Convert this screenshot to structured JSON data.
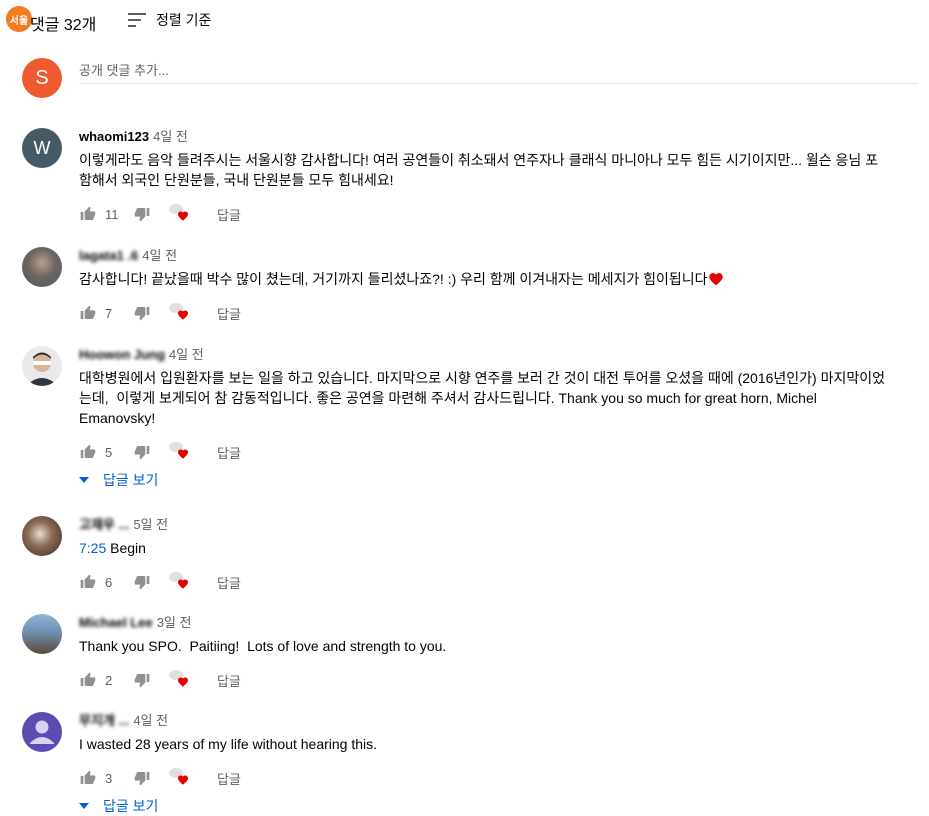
{
  "header": {
    "logo_text": "서울",
    "comment_count": "댓글 32개",
    "sort_label": "정렬 기준"
  },
  "add_comment": {
    "avatar_letter": "S",
    "placeholder": "공개 댓글 추가..."
  },
  "colors": {
    "blue": "#065fd4",
    "heart": "#e60000",
    "add_avatar": "#ef5b2e",
    "w_avatar": "#455a64",
    "person_avatar": "#5c4bb0"
  },
  "comments": [
    {
      "author": "whaomi123",
      "time": "4일 전",
      "avatar_letter": "W",
      "text": "이렇게라도 음악 들려주시는 서울시향 감사합니다! 여러 공연들이 취소돼서 연주자나 클래식 마니아나 모두 힘든 시기이지만... 윌슨 응님 포함해서 외국인 단원분들, 국내 단원분들 모두 힘내세요!",
      "likes": "11",
      "reply_label": "답글"
    },
    {
      "author": "lagata1 .6",
      "time": "4일 전",
      "text": "감사합니다! 끝났을때 박수 많이 쳤는데, 거기까지 들리셨나죠?! :) 우리 함께 이겨내자는 메세지가 힘이됩니다",
      "likes": "7",
      "reply_label": "답글"
    },
    {
      "author": "Hoowon Jung",
      "time": "4일 전",
      "text": "대학병원에서 입원환자를 보는 일을 하고 있습니다. 마지막으로 시향 연주를 보러 간 것이 대전 투어를 오셨을 때에 (2016년인가) 마지막이었는데,  이렇게 보게되어 참 감동적입니다. 좋은 공연을 마련해 주셔서 감사드립니다. Thank you so much for great horn, Michel Emanovsky!",
      "likes": "5",
      "reply_label": "답글",
      "show_replies": "답글 보기"
    },
    {
      "author": "고재우 ...",
      "time": "5일 전",
      "timestamp_link": "7:25",
      "text_after": " Begin",
      "likes": "6",
      "reply_label": "답글"
    },
    {
      "author": "Michael Lee",
      "time": "3일 전",
      "text": "Thank you SPO.  Paitiing!  Lots of love and strength to you.",
      "likes": "2",
      "reply_label": "답글"
    },
    {
      "author": "무지개 ...",
      "time": "4일 전",
      "text": "I wasted 28 years of my life without hearing this.",
      "likes": "3",
      "reply_label": "답글",
      "show_replies": "답글 보기"
    }
  ]
}
